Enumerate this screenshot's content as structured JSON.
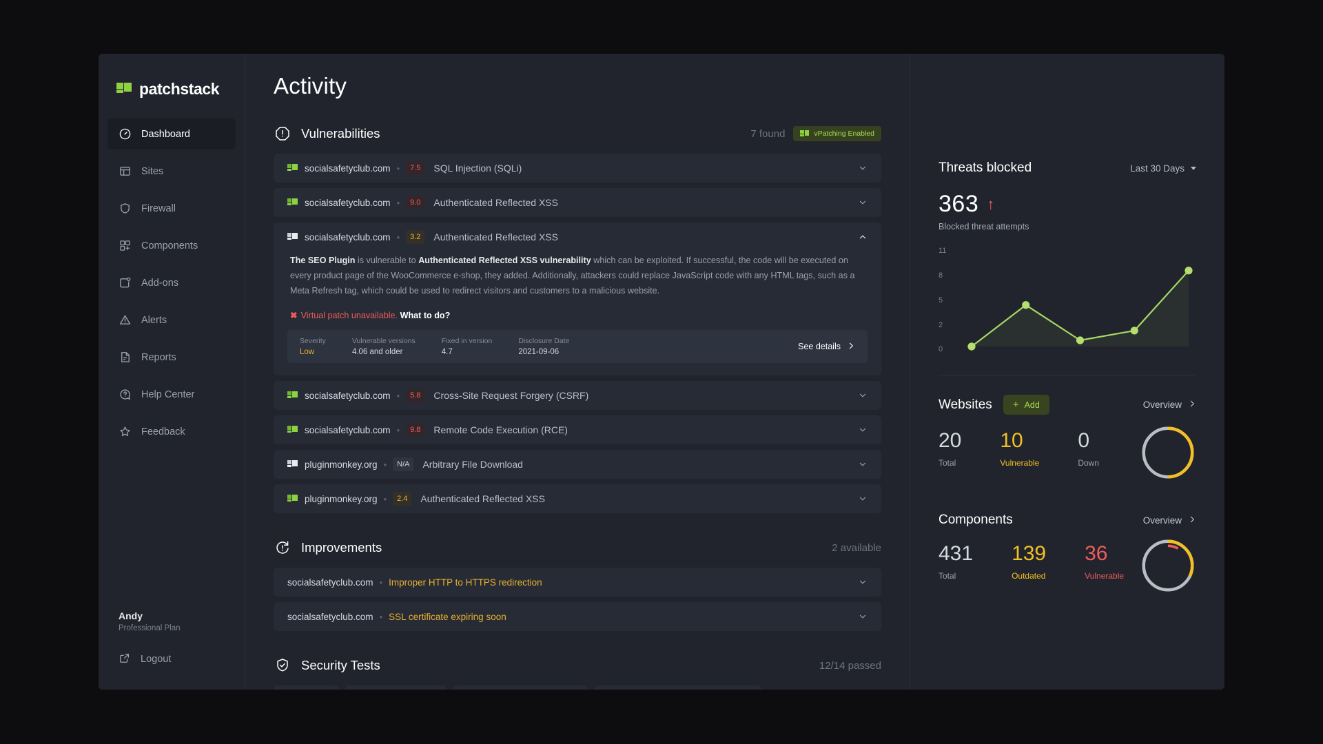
{
  "brand": {
    "name": "patchstack"
  },
  "sidebar": {
    "items": [
      {
        "label": "Dashboard",
        "icon": "gauge-icon",
        "active": true
      },
      {
        "label": "Sites",
        "icon": "layout-icon",
        "active": false
      },
      {
        "label": "Firewall",
        "icon": "shield-icon",
        "active": false
      },
      {
        "label": "Components",
        "icon": "grid-plus-icon",
        "active": false
      },
      {
        "label": "Add-ons",
        "icon": "addons-icon",
        "active": false
      },
      {
        "label": "Alerts",
        "icon": "warning-triangle-icon",
        "active": false
      },
      {
        "label": "Reports",
        "icon": "document-icon",
        "active": false
      },
      {
        "label": "Help Center",
        "icon": "question-circle-icon",
        "active": false
      },
      {
        "label": "Feedback",
        "icon": "star-icon",
        "active": false
      }
    ],
    "user": {
      "name": "Andy",
      "plan": "Professional Plan"
    },
    "logout": {
      "label": "Logout",
      "icon": "external-link-icon"
    }
  },
  "page": {
    "title": "Activity"
  },
  "vulnerabilities": {
    "title": "Vulnerabilities",
    "icon": "octagon-alert-icon",
    "count_label": "7 found",
    "badge": {
      "label": "vPatching Enabled"
    },
    "rows": [
      {
        "site": "socialsafetyclub.com",
        "favicon": "green",
        "score": "7.5",
        "score_level": "high",
        "name": "SQL Injection (SQLi)",
        "expanded": false
      },
      {
        "site": "socialsafetyclub.com",
        "favicon": "green",
        "score": "9.0",
        "score_level": "high",
        "name": "Authenticated Reflected XSS",
        "expanded": false
      },
      {
        "site": "socialsafetyclub.com",
        "favicon": "grey",
        "score": "3.2",
        "score_level": "med",
        "name": "Authenticated Reflected XSS",
        "expanded": true,
        "detail": {
          "lead": "The SEO Plugin",
          "t1": " is vulnerable to ",
          "emph": "Authenticated Reflected XSS vulnerability",
          "t2": " which can be exploited. If successful, the code will be executed on every product page of the WooCommerce e-shop, they added. Additionally, attackers could replace JavaScript code with any HTML tags, such as a Meta Refresh tag, which could be used to redirect visitors and customers to a malicious website.",
          "patch_mark": "✖",
          "patch_status": "Virtual patch unavailable.",
          "patch_cta": "What to do?",
          "meta": [
            {
              "key": "Severity",
              "value": "Low",
              "tone": "low"
            },
            {
              "key": "Vulnerable versions",
              "value": "4.06 and older",
              "tone": ""
            },
            {
              "key": "Fixed in version",
              "value": "4.7",
              "tone": ""
            },
            {
              "key": "Disclosure Date",
              "value": "2021-09-06",
              "tone": ""
            }
          ],
          "see_details": "See details"
        }
      },
      {
        "site": "socialsafetyclub.com",
        "favicon": "green",
        "score": "5.8",
        "score_level": "high",
        "name": "Cross-Site Request Forgery (CSRF)",
        "expanded": false
      },
      {
        "site": "socialsafetyclub.com",
        "favicon": "green",
        "score": "9.8",
        "score_level": "high",
        "name": "Remote Code Execution (RCE)",
        "expanded": false
      },
      {
        "site": "pluginmonkey.org",
        "favicon": "grey",
        "score": "N/A",
        "score_level": "na",
        "name": "Arbitrary File Download",
        "expanded": false
      },
      {
        "site": "pluginmonkey.org",
        "favicon": "green",
        "score": "2.4",
        "score_level": "med",
        "name": "Authenticated Reflected XSS",
        "expanded": false
      }
    ]
  },
  "improvements": {
    "title": "Improvements",
    "icon": "refresh-alert-icon",
    "count_label": "2 available",
    "rows": [
      {
        "site": "socialsafetyclub.com",
        "name": "Improper HTTP to HTTPS redirection"
      },
      {
        "site": "socialsafetyclub.com",
        "name": "SSL certificate expiring soon"
      }
    ]
  },
  "security_tests": {
    "title": "Security Tests",
    "icon": "shield-check-icon",
    "count_label": "12/14 passed"
  },
  "threats": {
    "title": "Threats blocked",
    "range_label": "Last 30 Days",
    "value": "363",
    "trend": "up",
    "subtitle": "Blocked threat attempts"
  },
  "websites": {
    "title": "Websites",
    "add_label": "Add",
    "overview_label": "Overview",
    "stats": [
      {
        "value": "20",
        "label": "Total",
        "tone": "grey"
      },
      {
        "value": "10",
        "label": "Vulnerable",
        "tone": "yellow"
      },
      {
        "value": "0",
        "label": "Down",
        "tone": "grey"
      }
    ],
    "donut": {
      "track_color": "#b9bdc4",
      "segments": [
        {
          "color": "#f2c024",
          "fraction": 0.5
        }
      ]
    }
  },
  "components": {
    "title": "Components",
    "overview_label": "Overview",
    "stats": [
      {
        "value": "431",
        "label": "Total",
        "tone": "grey"
      },
      {
        "value": "139",
        "label": "Outdated",
        "tone": "yellow"
      },
      {
        "value": "36",
        "label": "Vulnerable",
        "tone": "red"
      }
    ],
    "donut": {
      "track_color": "#b9bdc4",
      "segments": [
        {
          "color": "#f2c024",
          "fraction": 0.323
        },
        {
          "color": "#f05c5c",
          "fraction": 0.084
        }
      ]
    }
  },
  "colors": {
    "accent_green": "#8ed143",
    "warning_yellow": "#f2c024",
    "danger_red": "#f05c5c",
    "panel_bg": "#21242c",
    "card_bg": "#272b35"
  },
  "chart_data": {
    "type": "line",
    "title": "Threats blocked",
    "x": [
      0,
      1,
      2,
      3,
      4
    ],
    "values": [
      0,
      4.7,
      0.7,
      1.8,
      8.6
    ],
    "ylabel": "",
    "xlabel": "",
    "yticks": [
      0,
      2,
      5,
      8,
      11
    ],
    "ytick_labels": [
      "0",
      "2",
      "5",
      "8",
      "11"
    ],
    "ylim": [
      0,
      11
    ],
    "grid": false,
    "legend": false,
    "line_color": "#a8d862",
    "marker_color": "#b5de6e"
  }
}
